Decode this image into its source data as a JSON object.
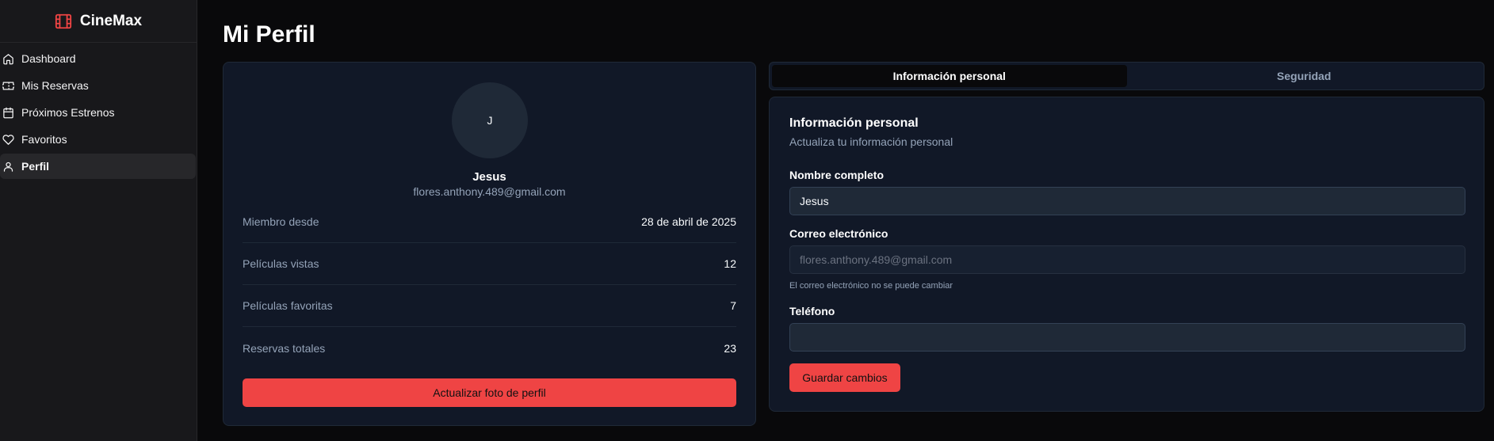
{
  "app": {
    "name": "CineMax"
  },
  "sidebar": {
    "items": [
      {
        "label": "Dashboard",
        "icon": "home-icon",
        "active": false
      },
      {
        "label": "Mis Reservas",
        "icon": "ticket-icon",
        "active": false
      },
      {
        "label": "Próximos Estrenos",
        "icon": "calendar-icon",
        "active": false
      },
      {
        "label": "Favoritos",
        "icon": "heart-icon",
        "active": false
      },
      {
        "label": "Perfil",
        "icon": "user-icon",
        "active": true
      }
    ]
  },
  "page": {
    "title": "Mi Perfil"
  },
  "profile": {
    "avatar_initial": "J",
    "name": "Jesus",
    "email": "flores.anthony.489@gmail.com",
    "stats": [
      {
        "label": "Miembro desde",
        "value": "28 de abril de 2025"
      },
      {
        "label": "Películas vistas",
        "value": "12"
      },
      {
        "label": "Películas favoritas",
        "value": "7"
      },
      {
        "label": "Reservas totales",
        "value": "23"
      }
    ],
    "update_photo_label": "Actualizar foto de perfil"
  },
  "tabs": [
    {
      "label": "Información personal",
      "active": true
    },
    {
      "label": "Seguridad",
      "active": false
    }
  ],
  "form": {
    "title": "Información personal",
    "subtitle": "Actualiza tu información personal",
    "name_label": "Nombre completo",
    "name_value": "Jesus",
    "email_label": "Correo electrónico",
    "email_value": "flores.anthony.489@gmail.com",
    "email_hint": "El correo electrónico no se puede cambiar",
    "phone_label": "Teléfono",
    "phone_value": "",
    "save_label": "Guardar cambios"
  },
  "colors": {
    "accent": "#ef4444",
    "background": "#09090b",
    "sidebar": "#18181b",
    "card": "#111827"
  }
}
